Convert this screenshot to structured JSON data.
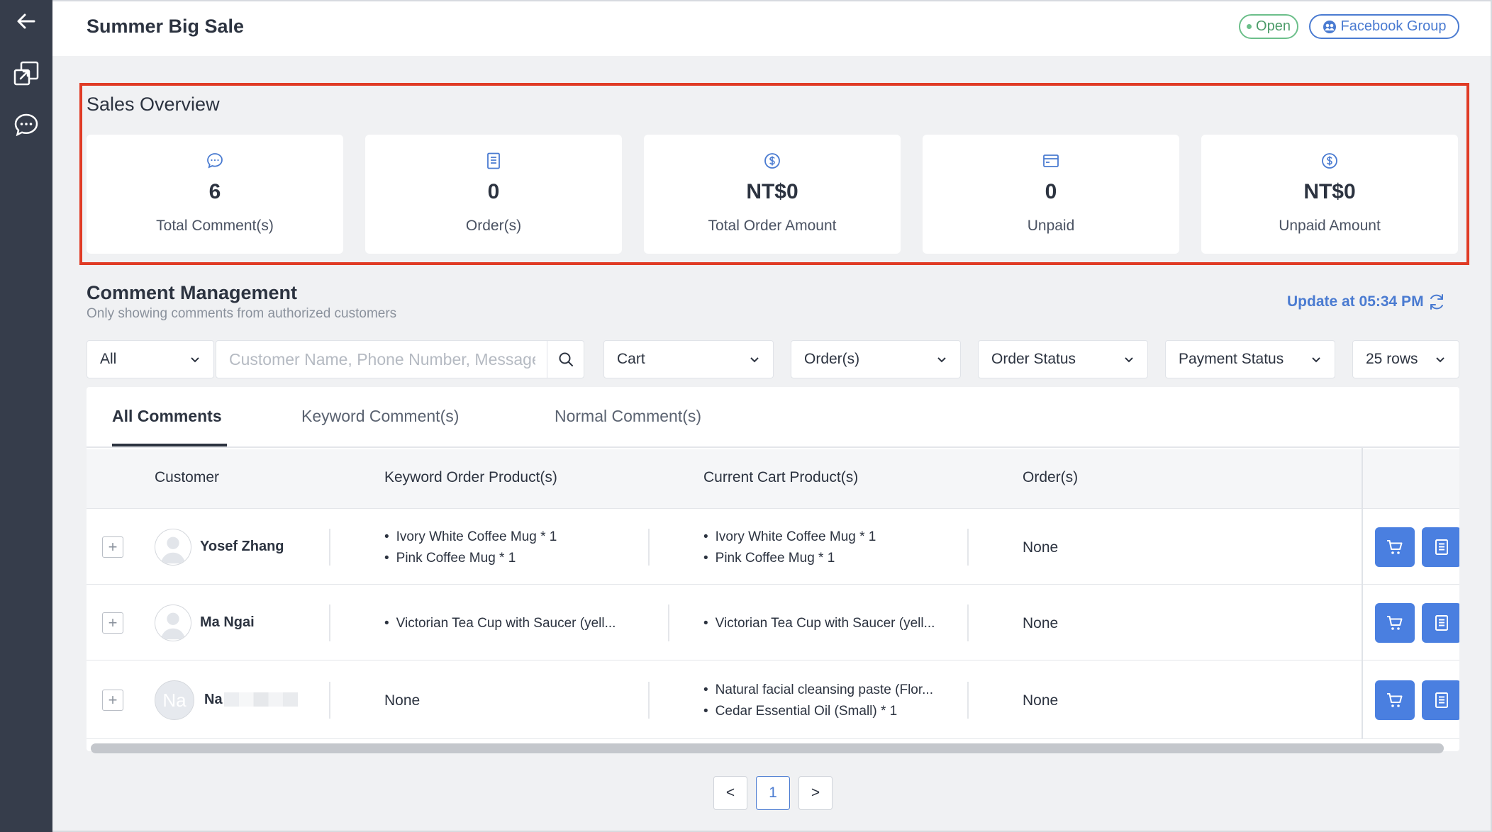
{
  "header": {
    "title": "Summer Big Sale",
    "status_label": "Open",
    "source_label": "Facebook Group"
  },
  "sidebar": {
    "icons": [
      "back-arrow-icon",
      "export-icon",
      "chat-icon"
    ]
  },
  "overview": {
    "title": "Sales Overview",
    "cards": [
      {
        "icon": "comment-icon",
        "value": "6",
        "label": "Total Comment(s)"
      },
      {
        "icon": "order-icon",
        "value": "0",
        "label": "Order(s)"
      },
      {
        "icon": "dollar-icon",
        "value": "NT$0",
        "label": "Total Order Amount"
      },
      {
        "icon": "card-icon",
        "value": "0",
        "label": "Unpaid"
      },
      {
        "icon": "dollar-icon",
        "value": "NT$0",
        "label": "Unpaid Amount"
      }
    ]
  },
  "comments": {
    "title": "Comment Management",
    "subtitle": "Only showing comments from authorized customers",
    "update_label": "Update at 05:34 PM",
    "filters": {
      "scope": "All",
      "search_placeholder": "Customer Name, Phone Number, Message",
      "cart": "Cart",
      "orders": "Order(s)",
      "order_status": "Order Status",
      "payment_status": "Payment Status",
      "rows": "25 rows"
    },
    "tabs": [
      "All Comments",
      "Keyword Comment(s)",
      "Normal Comment(s)"
    ],
    "columns": [
      "Customer",
      "Keyword Order Product(s)",
      "Current Cart Product(s)",
      "Order(s)"
    ],
    "rows": [
      {
        "customer": "Yosef Zhang",
        "keyword_products": [
          "Ivory White Coffee Mug * 1",
          "Pink Coffee Mug * 1"
        ],
        "cart_products": [
          "Ivory White Coffee Mug * 1",
          "Pink Coffee Mug * 1"
        ],
        "orders": "None"
      },
      {
        "customer": "Ma Ngai",
        "keyword_products": [
          "Victorian Tea Cup with Saucer (yell..."
        ],
        "cart_products": [
          "Victorian Tea Cup with Saucer (yell..."
        ],
        "orders": "None"
      },
      {
        "customer": "Na",
        "avatar_initials": "Na",
        "keyword_products_text": "None",
        "cart_products": [
          "Natural facial cleansing paste (Flor...",
          "Cedar Essential Oil (Small) * 1"
        ],
        "orders": "None"
      }
    ]
  },
  "pagination": {
    "prev": "<",
    "current": "1",
    "next": ">"
  },
  "colors": {
    "accent": "#4a7bd1",
    "sidebar": "#363d4b",
    "highlight": "#e03b25",
    "open": "#6cbf8a"
  }
}
